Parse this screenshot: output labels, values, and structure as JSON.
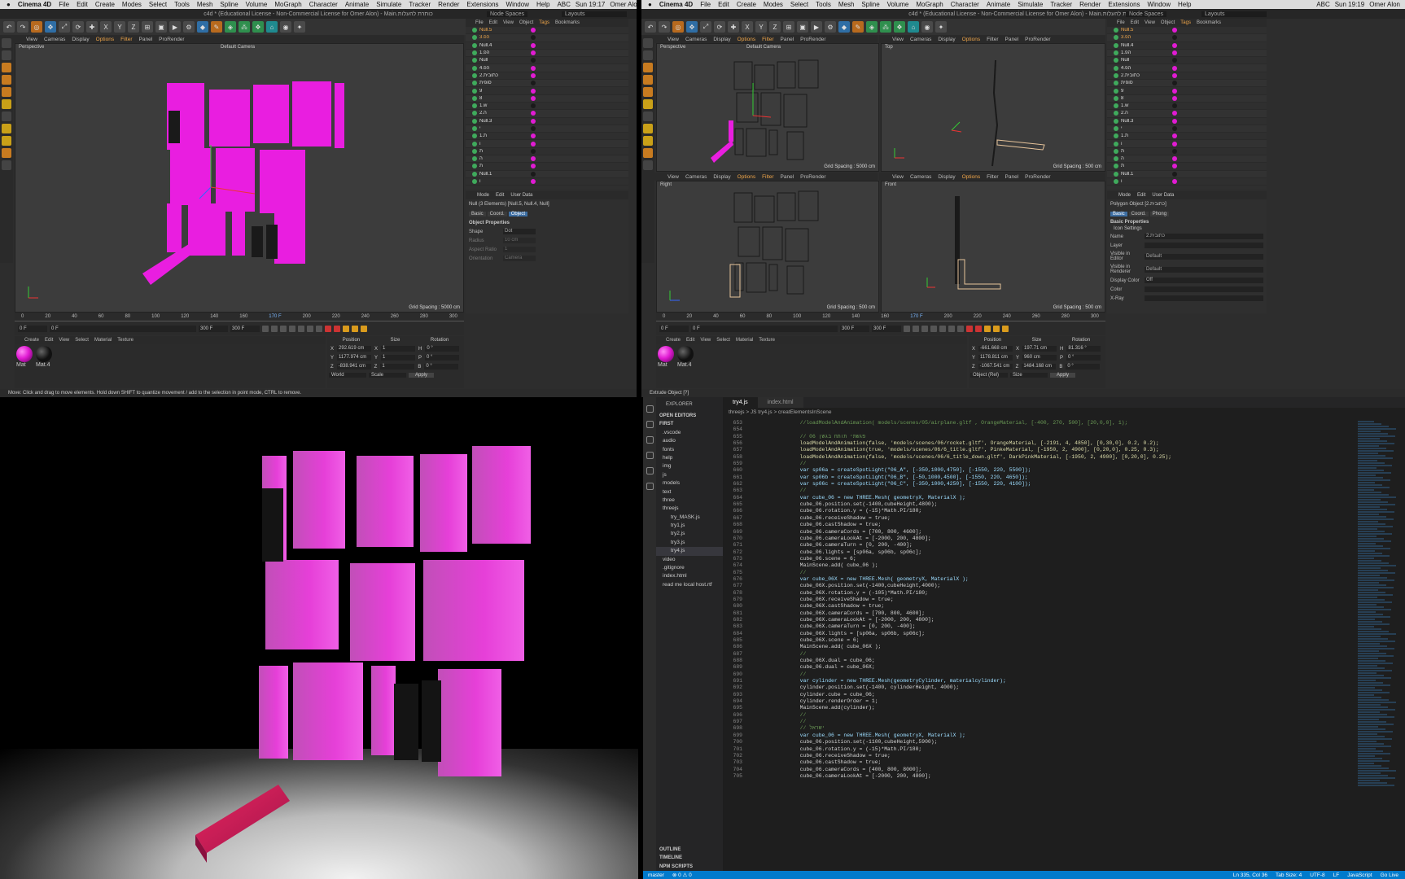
{
  "left_app": {
    "menu": [
      "Cinema 4D",
      "File",
      "Edit",
      "Create",
      "Modes",
      "Select",
      "Tools",
      "Mesh",
      "Spline",
      "Volume",
      "MoGraph",
      "Character",
      "Animate",
      "Simulate",
      "Tracker",
      "Render",
      "Extensions",
      "Window",
      "Help"
    ],
    "menu_right": [
      "ABC",
      "Sun 19:17",
      "Omer Alon"
    ],
    "title": "c4d * (Educational License - Non-Commercial License for Omer Alon) - Main.כותרת להעלות",
    "node_spaces": "Node Spaces",
    "layouts": "Layouts",
    "viewport_menu": [
      "View",
      "Cameras",
      "Display",
      "Options",
      "Filter",
      "Panel",
      "ProRender"
    ],
    "viewport_label": "Perspective",
    "camera_label": "Default Camera",
    "grid_spacing": "Grid Spacing : 5000 cm",
    "obj_menu": [
      "File",
      "Edit",
      "View",
      "Object",
      "Tags",
      "Bookmarks"
    ],
    "objects": [
      "Null.5",
      "3.הפ",
      "Null.4",
      "1.הפ",
      "Null",
      "4.הפ",
      "2.כתובית",
      "סופית",
      "9",
      "8",
      "1.w",
      "2.ה",
      "Null.3",
      "י",
      "1.ת",
      "ו",
      "ת",
      "ה",
      "ת",
      "Null.1",
      "ו"
    ],
    "attr_menu": [
      "Mode",
      "Edit",
      "User Data"
    ],
    "attr_object": "Null (3 Elements) [Null.5, Null.4, Null]",
    "attr_tabs": [
      "Basic",
      "Coord.",
      "Object"
    ],
    "attr_section": "Object Properties",
    "attr_rows": [
      {
        "k": "Shape",
        "v": "Dot"
      },
      {
        "k": "Radius",
        "v": "10 cm"
      },
      {
        "k": "Aspect Ratio",
        "v": "1"
      },
      {
        "k": "Orientation",
        "v": "Camera"
      }
    ],
    "ruler": [
      "0",
      "20",
      "40",
      "60",
      "80",
      "100",
      "120",
      "140",
      "160",
      "170 F",
      "200",
      "220",
      "240",
      "260",
      "280",
      "300"
    ],
    "frame_start": "0 F",
    "frame_cur": "0 F",
    "frame_end": "300 F",
    "frame_end2": "300 F",
    "mat_menu": [
      "Create",
      "Edit",
      "View",
      "Select",
      "Material",
      "Texture"
    ],
    "materials": [
      {
        "name": "Mat",
        "color": "#e11bd3"
      },
      {
        "name": "Mat.4",
        "color": "#1a1a1a"
      }
    ],
    "coord_headers": [
      "Position",
      "Size",
      "Rotation"
    ],
    "coords": [
      {
        "p": "X",
        "pv": "292.619 cm",
        "s": "X",
        "sv": "1",
        "r": "H",
        "rv": "0 °"
      },
      {
        "p": "Y",
        "pv": "1177.974 cm",
        "s": "Y",
        "sv": "1",
        "r": "P",
        "rv": "0 °"
      },
      {
        "p": "Z",
        "pv": "-838.941 cm",
        "s": "Z",
        "sv": "1",
        "r": "B",
        "rv": "0 °"
      }
    ],
    "coord_mode": "World",
    "coord_scale": "Scale",
    "apply": "Apply",
    "status": "Move: Click and drag to move elements. Hold down SHIFT to quantize movement / add to the selection in point mode, CTRL to remove."
  },
  "right_app": {
    "menu_right": [
      "ABC",
      "Sun 19:19",
      "Omer Alon"
    ],
    "views": [
      {
        "label": "Perspective",
        "cam": "Default Camera",
        "grid": "Grid Spacing : 5000 cm"
      },
      {
        "label": "Top",
        "cam": "",
        "grid": "Grid Spacing : 500 cm"
      },
      {
        "label": "Right",
        "cam": "",
        "grid": "Grid Spacing : 500 cm"
      },
      {
        "label": "Front",
        "cam": "",
        "grid": "Grid Spacing : 500 cm"
      }
    ],
    "attr_object": "Polygon Object [2.כתובית]",
    "attr_tabs": [
      "Basic",
      "Coord.",
      "Phong"
    ],
    "attr_section": "Basic Properties",
    "attr_sub": "Icon Settings",
    "attr_rows": [
      {
        "k": "Name",
        "v": "2.כתובית"
      },
      {
        "k": "Layer",
        "v": ""
      },
      {
        "k": "Visible in Editor",
        "v": "Default"
      },
      {
        "k": "Visible in Renderer",
        "v": "Default"
      },
      {
        "k": "Display Color",
        "v": "Off"
      },
      {
        "k": "Color",
        "v": ""
      },
      {
        "k": "X-Ray",
        "v": ""
      }
    ],
    "coords": [
      {
        "p": "X",
        "pv": "-661.668 cm",
        "s": "X",
        "sv": "197.71 cm",
        "r": "H",
        "rv": "81.316 °"
      },
      {
        "p": "Y",
        "pv": "1178.811 cm",
        "s": "Y",
        "sv": "960 cm",
        "r": "P",
        "rv": "0 °"
      },
      {
        "p": "Z",
        "pv": "-1067.541 cm",
        "s": "Z",
        "sv": "1484.168 cm",
        "r": "B",
        "rv": "0 °"
      }
    ],
    "coord_mode": "Object (Rel)",
    "coord_scale": "Size",
    "frame_end": "170 F",
    "status": "Extrude Object [?]"
  },
  "render_text": [
    "פגשתי",
    "תותח",
    "בגשן"
  ],
  "vscode": {
    "tabs": [
      "try4.js",
      "index.html"
    ],
    "breadcrumb": "threejs  >  JS try4.js  >  creatElementsInScene",
    "explorer_title": "EXPLORER",
    "open_editors": "OPEN EDITORS",
    "root": "FIRST",
    "tree": [
      ".vscode",
      "audio",
      "fonts",
      "help",
      "img",
      "js",
      "models",
      "text",
      "three",
      "threejs",
      "try_MASK.js",
      "try1.js",
      "try2.js",
      "try3.js",
      "try4.js",
      "video",
      ".gitignore",
      "index.html",
      "read me local host.rtf"
    ],
    "bottom_sections": [
      "OUTLINE",
      "TIMELINE",
      "NPM SCRIPTS"
    ],
    "code_lines": [
      {
        "n": "653",
        "t": "        //loadModelAndAnimation( models/scenes/05/airplane.gltf , OrangeMaterial, [-400, 270, 500], [20,0,0], 1);"
      },
      {
        "n": "654",
        "t": ""
      },
      {
        "n": "655",
        "t": "        // 06 פגשתי תותח בגשן"
      },
      {
        "n": "656",
        "t": "        loadModelAndAnimation(false, 'models/scenes/06/rocket.gltf', OrangeMaterial, [-2191, 4, 4850], [0,30,0], 0.2, 0.2);"
      },
      {
        "n": "657",
        "t": "        loadModelAndAnimation(true, 'models/scenes/06/6_title.gltf', PinkeMaterial, [-1950, 2, 4900], [0,20,0], 0.25, 0.3);"
      },
      {
        "n": "658",
        "t": "        loadModelAndAnimation(false, 'models/scenes/06/6_title_down.gltf', DarkPinkMaterial, [-1950, 2, 4900], [0,20,0], 0.25);"
      },
      {
        "n": "659",
        "t": "        //"
      },
      {
        "n": "660",
        "t": "        var sp06a = createSpotLight(\"06_A\", [-350,1000,4750], [-1550, 220, 5500]);"
      },
      {
        "n": "661",
        "t": "        var sp06b = createSpotLight(\"06_B\", [-50,1000,4500], [-1550, 220, 4650]);"
      },
      {
        "n": "662",
        "t": "        var sp06c = createSpotLight(\"06_C\", [-350,1000,4250], [-1550, 220, 4100]);"
      },
      {
        "n": "663",
        "t": "        //"
      },
      {
        "n": "664",
        "t": "        var cube_06 = new THREE.Mesh( geometryX, MaterialX );"
      },
      {
        "n": "665",
        "t": "        cube_06.position.set(-1400,cubeHeight,4800);"
      },
      {
        "n": "666",
        "t": "        cube_06.rotation.y = (-15)*Math.PI/180;"
      },
      {
        "n": "667",
        "t": "        cube_06.receiveShadow = true;"
      },
      {
        "n": "668",
        "t": "        cube_06.castShadow = true;"
      },
      {
        "n": "669",
        "t": "        cube_06.cameraCords = [700, 800, 4600];"
      },
      {
        "n": "670",
        "t": "        cube_06.cameraLookAt = [-2000, 200, 4800];"
      },
      {
        "n": "671",
        "t": "        cube_06.cameraTurn = [0, 200, -400];"
      },
      {
        "n": "672",
        "t": "        cube_06.lights = [sp06a, sp06b, sp06c];"
      },
      {
        "n": "673",
        "t": "        cube_06.scene = 6;"
      },
      {
        "n": "674",
        "t": "        MainScene.add( cube_06 );"
      },
      {
        "n": "675",
        "t": "        //"
      },
      {
        "n": "676",
        "t": "        var cube_06X = new THREE.Mesh( geometryX, MaterialX );"
      },
      {
        "n": "677",
        "t": "        cube_06X.position.set(-1400,cubeHeight,4000);"
      },
      {
        "n": "678",
        "t": "        cube_06X.rotation.y = (-105)*Math.PI/180;"
      },
      {
        "n": "679",
        "t": "        cube_06X.receiveShadow = true;"
      },
      {
        "n": "680",
        "t": "        cube_06X.castShadow = true;"
      },
      {
        "n": "681",
        "t": "        cube_06X.cameraCords = [700, 800, 4600];"
      },
      {
        "n": "682",
        "t": "        cube_06X.cameraLookAt = [-2000, 200, 4800];"
      },
      {
        "n": "683",
        "t": "        cube_06X.cameraTurn = [0, 200, -400];"
      },
      {
        "n": "684",
        "t": "        cube_06X.lights = [sp06a, sp06b, sp06c];"
      },
      {
        "n": "685",
        "t": "        cube_06X.scene = 6;"
      },
      {
        "n": "686",
        "t": "        MainScene.add( cube_06X );"
      },
      {
        "n": "687",
        "t": "        //"
      },
      {
        "n": "688",
        "t": "        cube_06X.dual = cube_06;"
      },
      {
        "n": "689",
        "t": "        cube_06.dual = cube_06X;"
      },
      {
        "n": "690",
        "t": "        //"
      },
      {
        "n": "691",
        "t": "        var cylinder = new THREE.Mesh(geometryCylinder, materialcylinder);"
      },
      {
        "n": "692",
        "t": "        cylinder.position.set(-1400, cylinderHeight, 4000);"
      },
      {
        "n": "693",
        "t": "        cylinder.cube = cube_06;"
      },
      {
        "n": "694",
        "t": "        cylinder.renderOrder = 1;"
      },
      {
        "n": "695",
        "t": "        MainScene.add(cylinder);"
      },
      {
        "n": "696",
        "t": "        //"
      },
      {
        "n": "697",
        "t": "        //"
      },
      {
        "n": "698",
        "t": "        // ישראל"
      },
      {
        "n": "699",
        "t": "        var cube_06 = new THREE.Mesh( geometryX, MaterialX );"
      },
      {
        "n": "700",
        "t": "        cube_06.position.set(-1100,cubeHeight,5900);"
      },
      {
        "n": "701",
        "t": "        cube_06.rotation.y = (-15)*Math.PI/180;"
      },
      {
        "n": "702",
        "t": "        cube_06.receiveShadow = true;"
      },
      {
        "n": "703",
        "t": "        cube_06.castShadow = true;"
      },
      {
        "n": "704",
        "t": "        cube_06.cameraCords = [400, 800, 8000];"
      },
      {
        "n": "705",
        "t": "        cube_06.cameraLookAt = [-2000, 200, 4800];"
      }
    ],
    "status_left": [
      "master",
      "⊗ 0 ⚠ 0"
    ],
    "status_right": [
      "Ln 335, Col 36",
      "Tab Size: 4",
      "UTF-8",
      "LF",
      "JavaScript",
      "Go Live"
    ]
  }
}
